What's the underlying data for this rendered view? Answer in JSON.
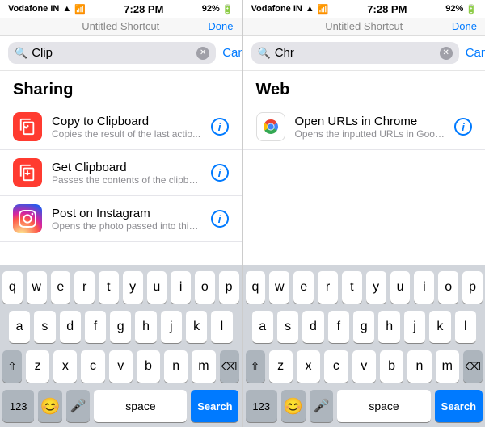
{
  "panels": [
    {
      "id": "left",
      "status": {
        "carrier": "Vodafone IN",
        "time": "7:28 PM",
        "battery": "92%"
      },
      "title": "Untitled Shortcut",
      "done_label": "Done",
      "search": {
        "query": "Clip",
        "cancel_label": "Cancel",
        "placeholder": ""
      },
      "section": {
        "header": "Sharing",
        "items": [
          {
            "id": "copy-clipboard",
            "title": "Copy to Clipboard",
            "subtitle": "Copies the result of the last actio...",
            "icon_type": "clipboard-copy"
          },
          {
            "id": "get-clipboard",
            "title": "Get Clipboard",
            "subtitle": "Passes the contents of the clipbo...",
            "icon_type": "clipboard-get"
          },
          {
            "id": "post-instagram",
            "title": "Post on Instagram",
            "subtitle": "Opens the photo passed into this...",
            "icon_type": "instagram"
          }
        ]
      },
      "keyboard": {
        "rows": [
          [
            "q",
            "w",
            "e",
            "r",
            "t",
            "y",
            "u",
            "i",
            "o",
            "p"
          ],
          [
            "a",
            "s",
            "d",
            "f",
            "g",
            "h",
            "j",
            "k",
            "l"
          ],
          [
            "⇧",
            "z",
            "x",
            "c",
            "v",
            "b",
            "n",
            "m",
            "⌫"
          ],
          [
            "123",
            "😊",
            "🎤",
            "space",
            "Search"
          ]
        ]
      }
    },
    {
      "id": "right",
      "status": {
        "carrier": "Vodafone IN",
        "time": "7:28 PM",
        "battery": "92%"
      },
      "title": "Untitled Shortcut",
      "done_label": "Done",
      "search": {
        "query": "Chr",
        "cancel_label": "Cancel",
        "placeholder": ""
      },
      "section": {
        "header": "Web",
        "items": [
          {
            "id": "open-chrome",
            "title": "Open URLs in Chrome",
            "subtitle": "Opens the inputted URLs in Goog...",
            "icon_type": "chrome"
          }
        ]
      },
      "keyboard": {
        "rows": [
          [
            "q",
            "w",
            "e",
            "r",
            "t",
            "y",
            "u",
            "i",
            "o",
            "p"
          ],
          [
            "a",
            "s",
            "d",
            "f",
            "g",
            "h",
            "j",
            "k",
            "l"
          ],
          [
            "⇧",
            "z",
            "x",
            "c",
            "v",
            "b",
            "n",
            "m",
            "⌫"
          ],
          [
            "123",
            "😊",
            "🎤",
            "space",
            "Search"
          ]
        ]
      }
    }
  ]
}
